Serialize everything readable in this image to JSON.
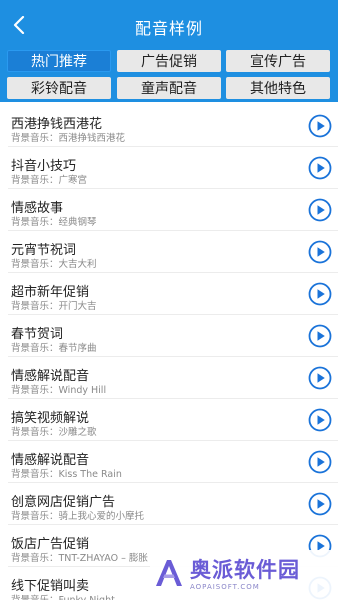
{
  "header": {
    "title": "配音样例"
  },
  "tabs": [
    {
      "label": "热门推荐",
      "active": true
    },
    {
      "label": "广告促销",
      "active": false
    },
    {
      "label": "宣传广告",
      "active": false
    },
    {
      "label": "彩铃配音",
      "active": false
    },
    {
      "label": "童声配音",
      "active": false
    },
    {
      "label": "其他特色",
      "active": false
    }
  ],
  "items": [
    {
      "title": "西港挣钱西港花",
      "music": "背景音乐：西港挣钱西港花"
    },
    {
      "title": "抖音小技巧",
      "music": "背景音乐：广寒宫"
    },
    {
      "title": "情感故事",
      "music": "背景音乐：经典钢琴"
    },
    {
      "title": "元宵节祝词",
      "music": "背景音乐：大吉大利"
    },
    {
      "title": "超市新年促销",
      "music": "背景音乐：开门大吉"
    },
    {
      "title": "春节贺词",
      "music": "背景音乐：春节序曲"
    },
    {
      "title": "情感解说配音",
      "music": "背景音乐：Windy Hill"
    },
    {
      "title": "搞笑视频解说",
      "music": "背景音乐：沙雕之歌"
    },
    {
      "title": "情感解说配音",
      "music": "背景音乐：Kiss The Rain"
    },
    {
      "title": "创意网店促销广告",
      "music": "背景音乐：骑上我心爱的小摩托"
    },
    {
      "title": "饭店广告促销",
      "music": "背景音乐：TNT-ZHAYAO – 膨胀"
    },
    {
      "title": "线下促销叫卖",
      "music": "背景音乐：Funky Night"
    }
  ],
  "watermark": {
    "text": "奥派软件园",
    "sub": "AOPAISOFT.COM"
  },
  "colors": {
    "accent": "#1e8fe1",
    "play": "#1a73d9",
    "watermark": "#6a5cd6"
  },
  "icons": {
    "back": "chevron-left-icon",
    "play": "play-circle-icon",
    "logo": "a-logo-icon"
  }
}
